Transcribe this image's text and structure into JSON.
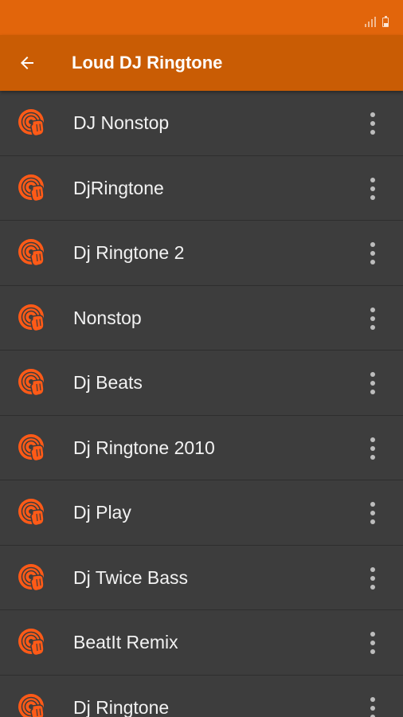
{
  "status_bar": {
    "signal_icon": "signal-icon",
    "battery_icon": "battery-icon"
  },
  "app_bar": {
    "back_icon": "arrow-back-icon",
    "title": "Loud DJ Ringtone",
    "background": "#c95c04"
  },
  "colors": {
    "accent": "#e2650b",
    "icon_orange": "#ff5a17",
    "list_background": "#3d3d3d"
  },
  "ringtones": [
    {
      "title": "DJ Nonstop",
      "icon": "dj-turntable-icon",
      "menu_icon": "more-vert-icon"
    },
    {
      "title": "DjRingtone",
      "icon": "dj-turntable-icon",
      "menu_icon": "more-vert-icon"
    },
    {
      "title": "Dj Ringtone 2",
      "icon": "dj-turntable-icon",
      "menu_icon": "more-vert-icon"
    },
    {
      "title": "Nonstop",
      "icon": "dj-turntable-icon",
      "menu_icon": "more-vert-icon"
    },
    {
      "title": "Dj Beats",
      "icon": "dj-turntable-icon",
      "menu_icon": "more-vert-icon"
    },
    {
      "title": "Dj Ringtone 2010",
      "icon": "dj-turntable-icon",
      "menu_icon": "more-vert-icon"
    },
    {
      "title": "Dj Play",
      "icon": "dj-turntable-icon",
      "menu_icon": "more-vert-icon"
    },
    {
      "title": "Dj Twice Bass",
      "icon": "dj-turntable-icon",
      "menu_icon": "more-vert-icon"
    },
    {
      "title": "BeatIt Remix",
      "icon": "dj-turntable-icon",
      "menu_icon": "more-vert-icon"
    },
    {
      "title": "Dj Ringtone",
      "icon": "dj-turntable-icon",
      "menu_icon": "more-vert-icon"
    }
  ]
}
